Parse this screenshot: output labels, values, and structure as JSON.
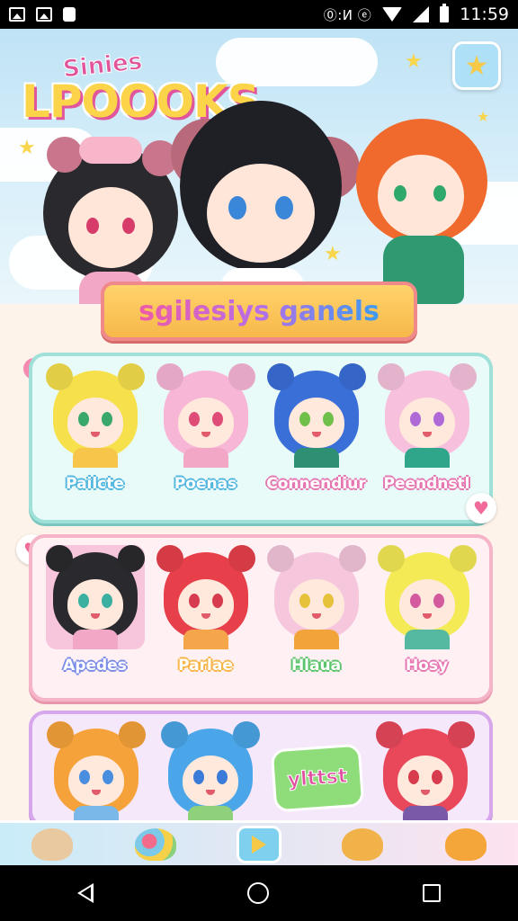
{
  "status_bar": {
    "indicators": "⓪:И ⓔ",
    "time": "11:59",
    "icons": [
      "image-icon",
      "photo-icon",
      "lock-icon",
      "wifi-icon",
      "signal-icon",
      "battery-icon"
    ]
  },
  "banner": {
    "logo_small": "Sinies",
    "logo_big": "LPOOOKS",
    "star_button_icon": "star-icon"
  },
  "title_plate": {
    "text": "sgilesiys ganels"
  },
  "rows": [
    {
      "characters": [
        {
          "name": "Pailcte",
          "hair": "#f6e04c",
          "eyes": "#3aa86b",
          "label_color": "#55b8e0",
          "body": "#f6c54a"
        },
        {
          "name": "Poenas",
          "hair": "#f8b6d6",
          "eyes": "#e04c78",
          "label_color": "#55b8e0",
          "body": "#f2a7c6"
        },
        {
          "name": "Connendiur",
          "hair": "#3a6fd8",
          "eyes": "#6fc04a",
          "label_color": "#e577b3",
          "body": "#2f8f73"
        },
        {
          "name": "Peendnstl",
          "hair": "#f7c1dd",
          "eyes": "#b06ad8",
          "label_color": "#e577b3",
          "body": "#2fa58a"
        }
      ]
    },
    {
      "characters": [
        {
          "name": "Apedes",
          "hair": "#2a2a2e",
          "eyes": "#3bb0a0",
          "label_color": "#7b8de8",
          "body": "#f2a7c6",
          "selected": true
        },
        {
          "name": "Parlae",
          "hair": "#e8404a",
          "eyes": "#d63b4e",
          "label_color": "#f7b64a",
          "body": "#f5a54a"
        },
        {
          "name": "Hlaua",
          "hair": "#f5c6dc",
          "eyes": "#e6c23a",
          "label_color": "#5cc46b",
          "body": "#f2a43a"
        },
        {
          "name": "Hosy",
          "hair": "#f3ea55",
          "eyes": "#d45aa0",
          "label_color": "#e577b3",
          "body": "#55b8a0"
        }
      ]
    },
    {
      "characters": [
        {
          "name": "",
          "hair": "#f6a23a",
          "eyes": "#4a8ee0",
          "label_color": "#55b8e0",
          "body": "#79b8e8"
        },
        {
          "name": "",
          "hair": "#4aa6e8",
          "eyes": "#3a7ad8",
          "label_color": "#55b8e0",
          "body": "#8fd07a"
        },
        {
          "name": "",
          "hair": "#e8485a",
          "eyes": "#d63b4e",
          "label_color": "#55b8e0",
          "body": "#7a5aa8"
        }
      ],
      "special_tag": "ylttst"
    }
  ],
  "bottom_bar": {
    "items": [
      "dog-icon",
      "candy-bowl-icon",
      "play-icon",
      "bear-icon",
      "lion-icon"
    ]
  },
  "nav_bar": {
    "items": [
      "back-icon",
      "home-icon",
      "recent-apps-icon"
    ]
  },
  "colors": {
    "accent_pink": "#f06b9a",
    "accent_yellow": "#f7c948",
    "sky": "#bfe3f5"
  }
}
